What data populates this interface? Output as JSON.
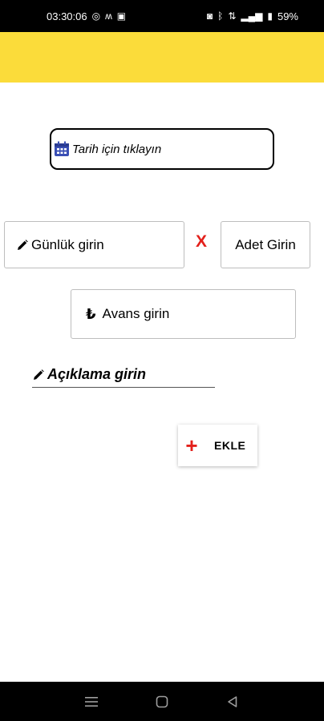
{
  "status_bar": {
    "time": "03:30:06",
    "battery": "59%"
  },
  "date_picker": {
    "label": "Tarih için tıklayın",
    "icon": "calendar-icon"
  },
  "daily_field": {
    "label": "Günlük girin",
    "icon": "pencil-icon"
  },
  "multiply_sign": "X",
  "count_field": {
    "label": "Adet Girin"
  },
  "advance_field": {
    "label": "Avans girin",
    "icon": "₺"
  },
  "description_field": {
    "label": "Açıklama girin",
    "icon": "pencil-icon"
  },
  "add_button": {
    "label": "EKLE",
    "icon": "+"
  },
  "colors": {
    "app_bar": "#fbdc3a",
    "accent_red": "#e3201b",
    "calendar_blue": "#3a4fb4"
  }
}
